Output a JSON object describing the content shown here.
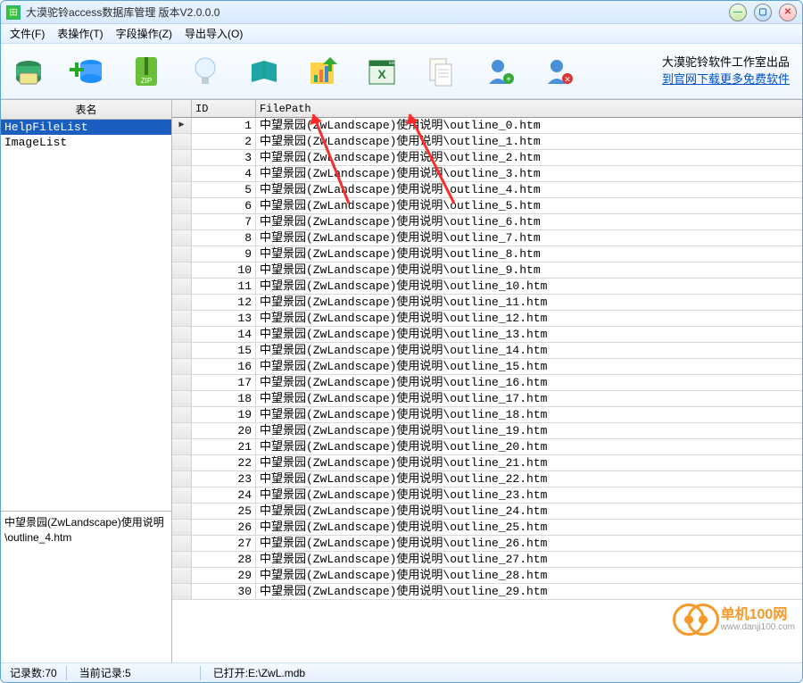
{
  "window_title": "大漠驼铃access数据库管理 版本V2.0.0.0",
  "menus": {
    "file": "文件(F)",
    "table": "表操作(T)",
    "field": "字段操作(Z)",
    "import": "导出导入(O)"
  },
  "promo": {
    "line1": "大漠驼铃软件工作室出品",
    "link": "到官网下载更多免费软件"
  },
  "sidebar": {
    "header": "表名",
    "items": [
      "HelpFileList",
      "ImageList"
    ],
    "selected": 0,
    "info": "中望景园(ZwLandscape)使用说明\\outline_4.htm"
  },
  "grid": {
    "columns": [
      "ID",
      "FilePath"
    ],
    "filepath_prefix": "中望景园(ZwLandscape)使用说明\\outline_",
    "filepath_suffix": ".htm",
    "rows": [
      {
        "id": 1,
        "n": 0
      },
      {
        "id": 2,
        "n": 1
      },
      {
        "id": 3,
        "n": 2
      },
      {
        "id": 4,
        "n": 3
      },
      {
        "id": 5,
        "n": 4
      },
      {
        "id": 6,
        "n": 5
      },
      {
        "id": 7,
        "n": 6
      },
      {
        "id": 8,
        "n": 7
      },
      {
        "id": 9,
        "n": 8
      },
      {
        "id": 10,
        "n": 9
      },
      {
        "id": 11,
        "n": 10
      },
      {
        "id": 12,
        "n": 11
      },
      {
        "id": 13,
        "n": 12
      },
      {
        "id": 14,
        "n": 13
      },
      {
        "id": 15,
        "n": 14
      },
      {
        "id": 16,
        "n": 15
      },
      {
        "id": 17,
        "n": 16
      },
      {
        "id": 18,
        "n": 17
      },
      {
        "id": 19,
        "n": 18
      },
      {
        "id": 20,
        "n": 19
      },
      {
        "id": 21,
        "n": 20
      },
      {
        "id": 22,
        "n": 21
      },
      {
        "id": 23,
        "n": 22
      },
      {
        "id": 24,
        "n": 23
      },
      {
        "id": 25,
        "n": 24
      },
      {
        "id": 26,
        "n": 25
      },
      {
        "id": 27,
        "n": 26
      },
      {
        "id": 28,
        "n": 27
      },
      {
        "id": 29,
        "n": 28
      },
      {
        "id": 30,
        "n": 29
      }
    ],
    "current_row_index": 0
  },
  "status": {
    "record_count_label": "记录数:70",
    "current_record_label": "当前记录:5",
    "opened_label": "已打开:E:\\ZwL.mdb"
  },
  "watermark": {
    "brand": "单机100网",
    "sub": "www.danji100.com"
  }
}
